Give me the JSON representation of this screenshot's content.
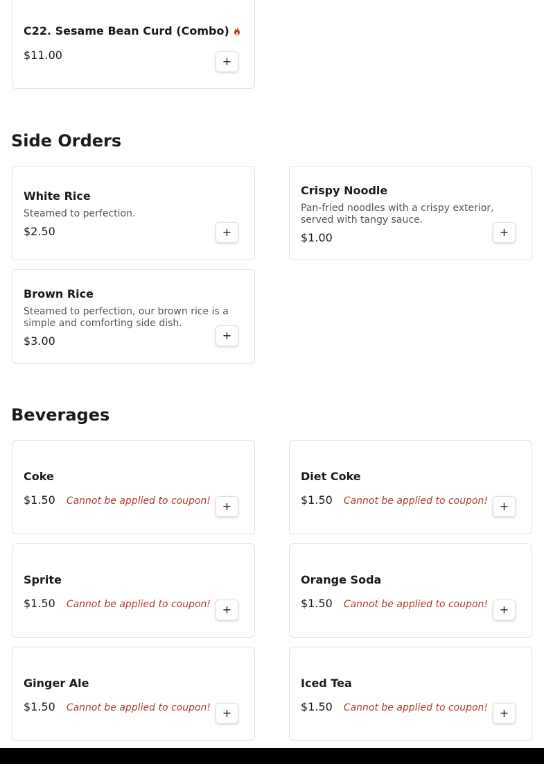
{
  "colors": {
    "accent": "#b03a2e",
    "flame": "#c0392b",
    "text": "#1a1a1a",
    "muted": "#555555",
    "border": "#e2e2e2"
  },
  "add_label": "+",
  "top_item": {
    "name": "C22. Sesame Bean Curd (Combo)",
    "price": "$11.00",
    "icon": "flame-icon"
  },
  "sections": {
    "side_orders": {
      "title": "Side Orders",
      "items": [
        {
          "name": "White Rice",
          "description": "Steamed to perfection.",
          "price": "$2.50"
        },
        {
          "name": "Crispy Noodle",
          "description": "Pan-fried noodles with a crispy exterior, served with tangy sauce.",
          "price": "$1.00"
        },
        {
          "name": "Brown Rice",
          "description": "Steamed to perfection, our brown rice is a simple and comforting side dish.",
          "price": "$3.00"
        }
      ]
    },
    "beverages": {
      "title": "Beverages",
      "items": [
        {
          "name": "Coke",
          "price": "$1.50",
          "note": "Cannot be applied to coupon!"
        },
        {
          "name": "Diet Coke",
          "price": "$1.50",
          "note": "Cannot be applied to coupon!"
        },
        {
          "name": "Sprite",
          "price": "$1.50",
          "note": "Cannot be applied to coupon!"
        },
        {
          "name": "Orange Soda",
          "price": "$1.50",
          "note": "Cannot be applied to coupon!"
        },
        {
          "name": "Ginger Ale",
          "price": "$1.50",
          "note": "Cannot be applied to coupon!"
        },
        {
          "name": "Iced Tea",
          "price": "$1.50",
          "note": "Cannot be applied to coupon!"
        }
      ]
    }
  }
}
